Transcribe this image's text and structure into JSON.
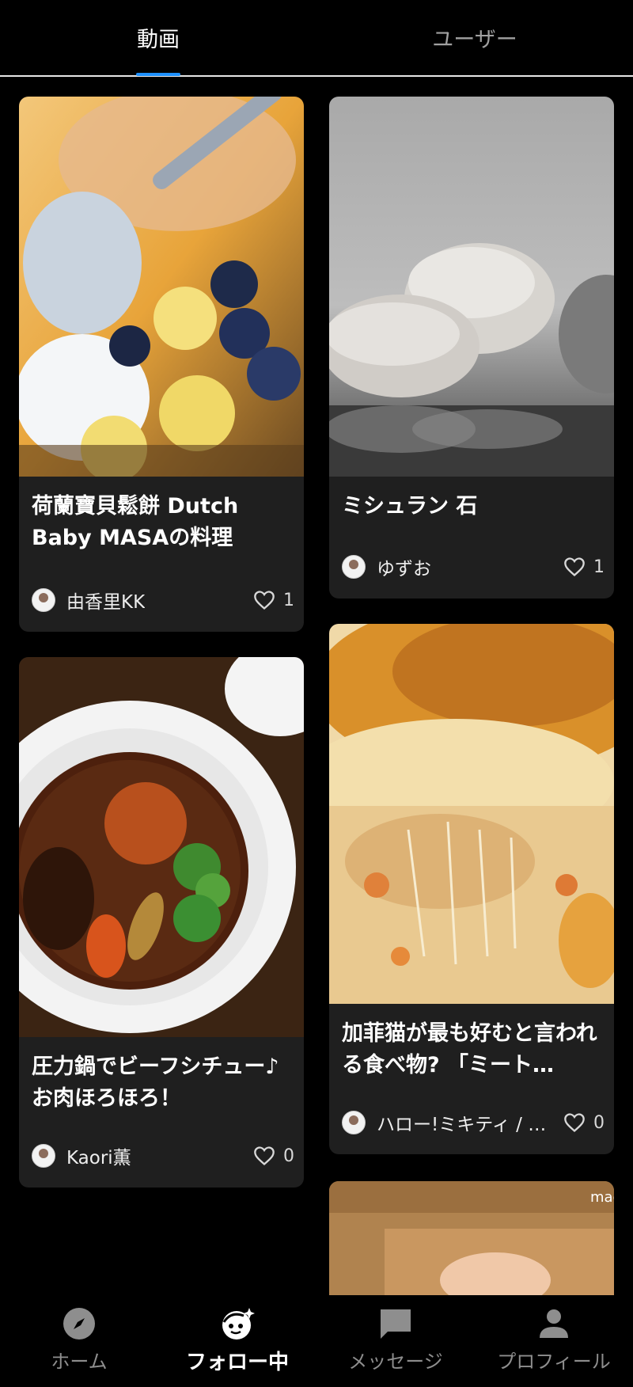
{
  "tabs": {
    "videos": "動画",
    "users": "ユーザー"
  },
  "cards": [
    {
      "title": "荷蘭寶貝鬆餅 Dutch Baby MASAの料理",
      "author": "由香里KK",
      "likes": "1"
    },
    {
      "title": "ミシュラン 石",
      "author": "ゆずお",
      "likes": "1"
    },
    {
      "title": "圧力鍋でビーフシチュー♪お肉ほろほろ！",
      "author": "Kaori薫",
      "likes": "0"
    },
    {
      "title": "加菲猫が最も好むと言われる食べ物? 「ミート…",
      "author": "ハロー!ミキティ / …",
      "likes": "0"
    }
  ],
  "partial_card_watermark": "mac",
  "nav": [
    {
      "label": "ホーム",
      "icon": "compass-icon"
    },
    {
      "label": "フォロー中",
      "icon": "face-sparkle-icon"
    },
    {
      "label": "メッセージ",
      "icon": "chat-bubble-icon"
    },
    {
      "label": "プロフィール",
      "icon": "person-icon"
    }
  ],
  "colors": {
    "background": "#000000",
    "card": "#1f1f1f",
    "accent": "#1e90ff"
  }
}
